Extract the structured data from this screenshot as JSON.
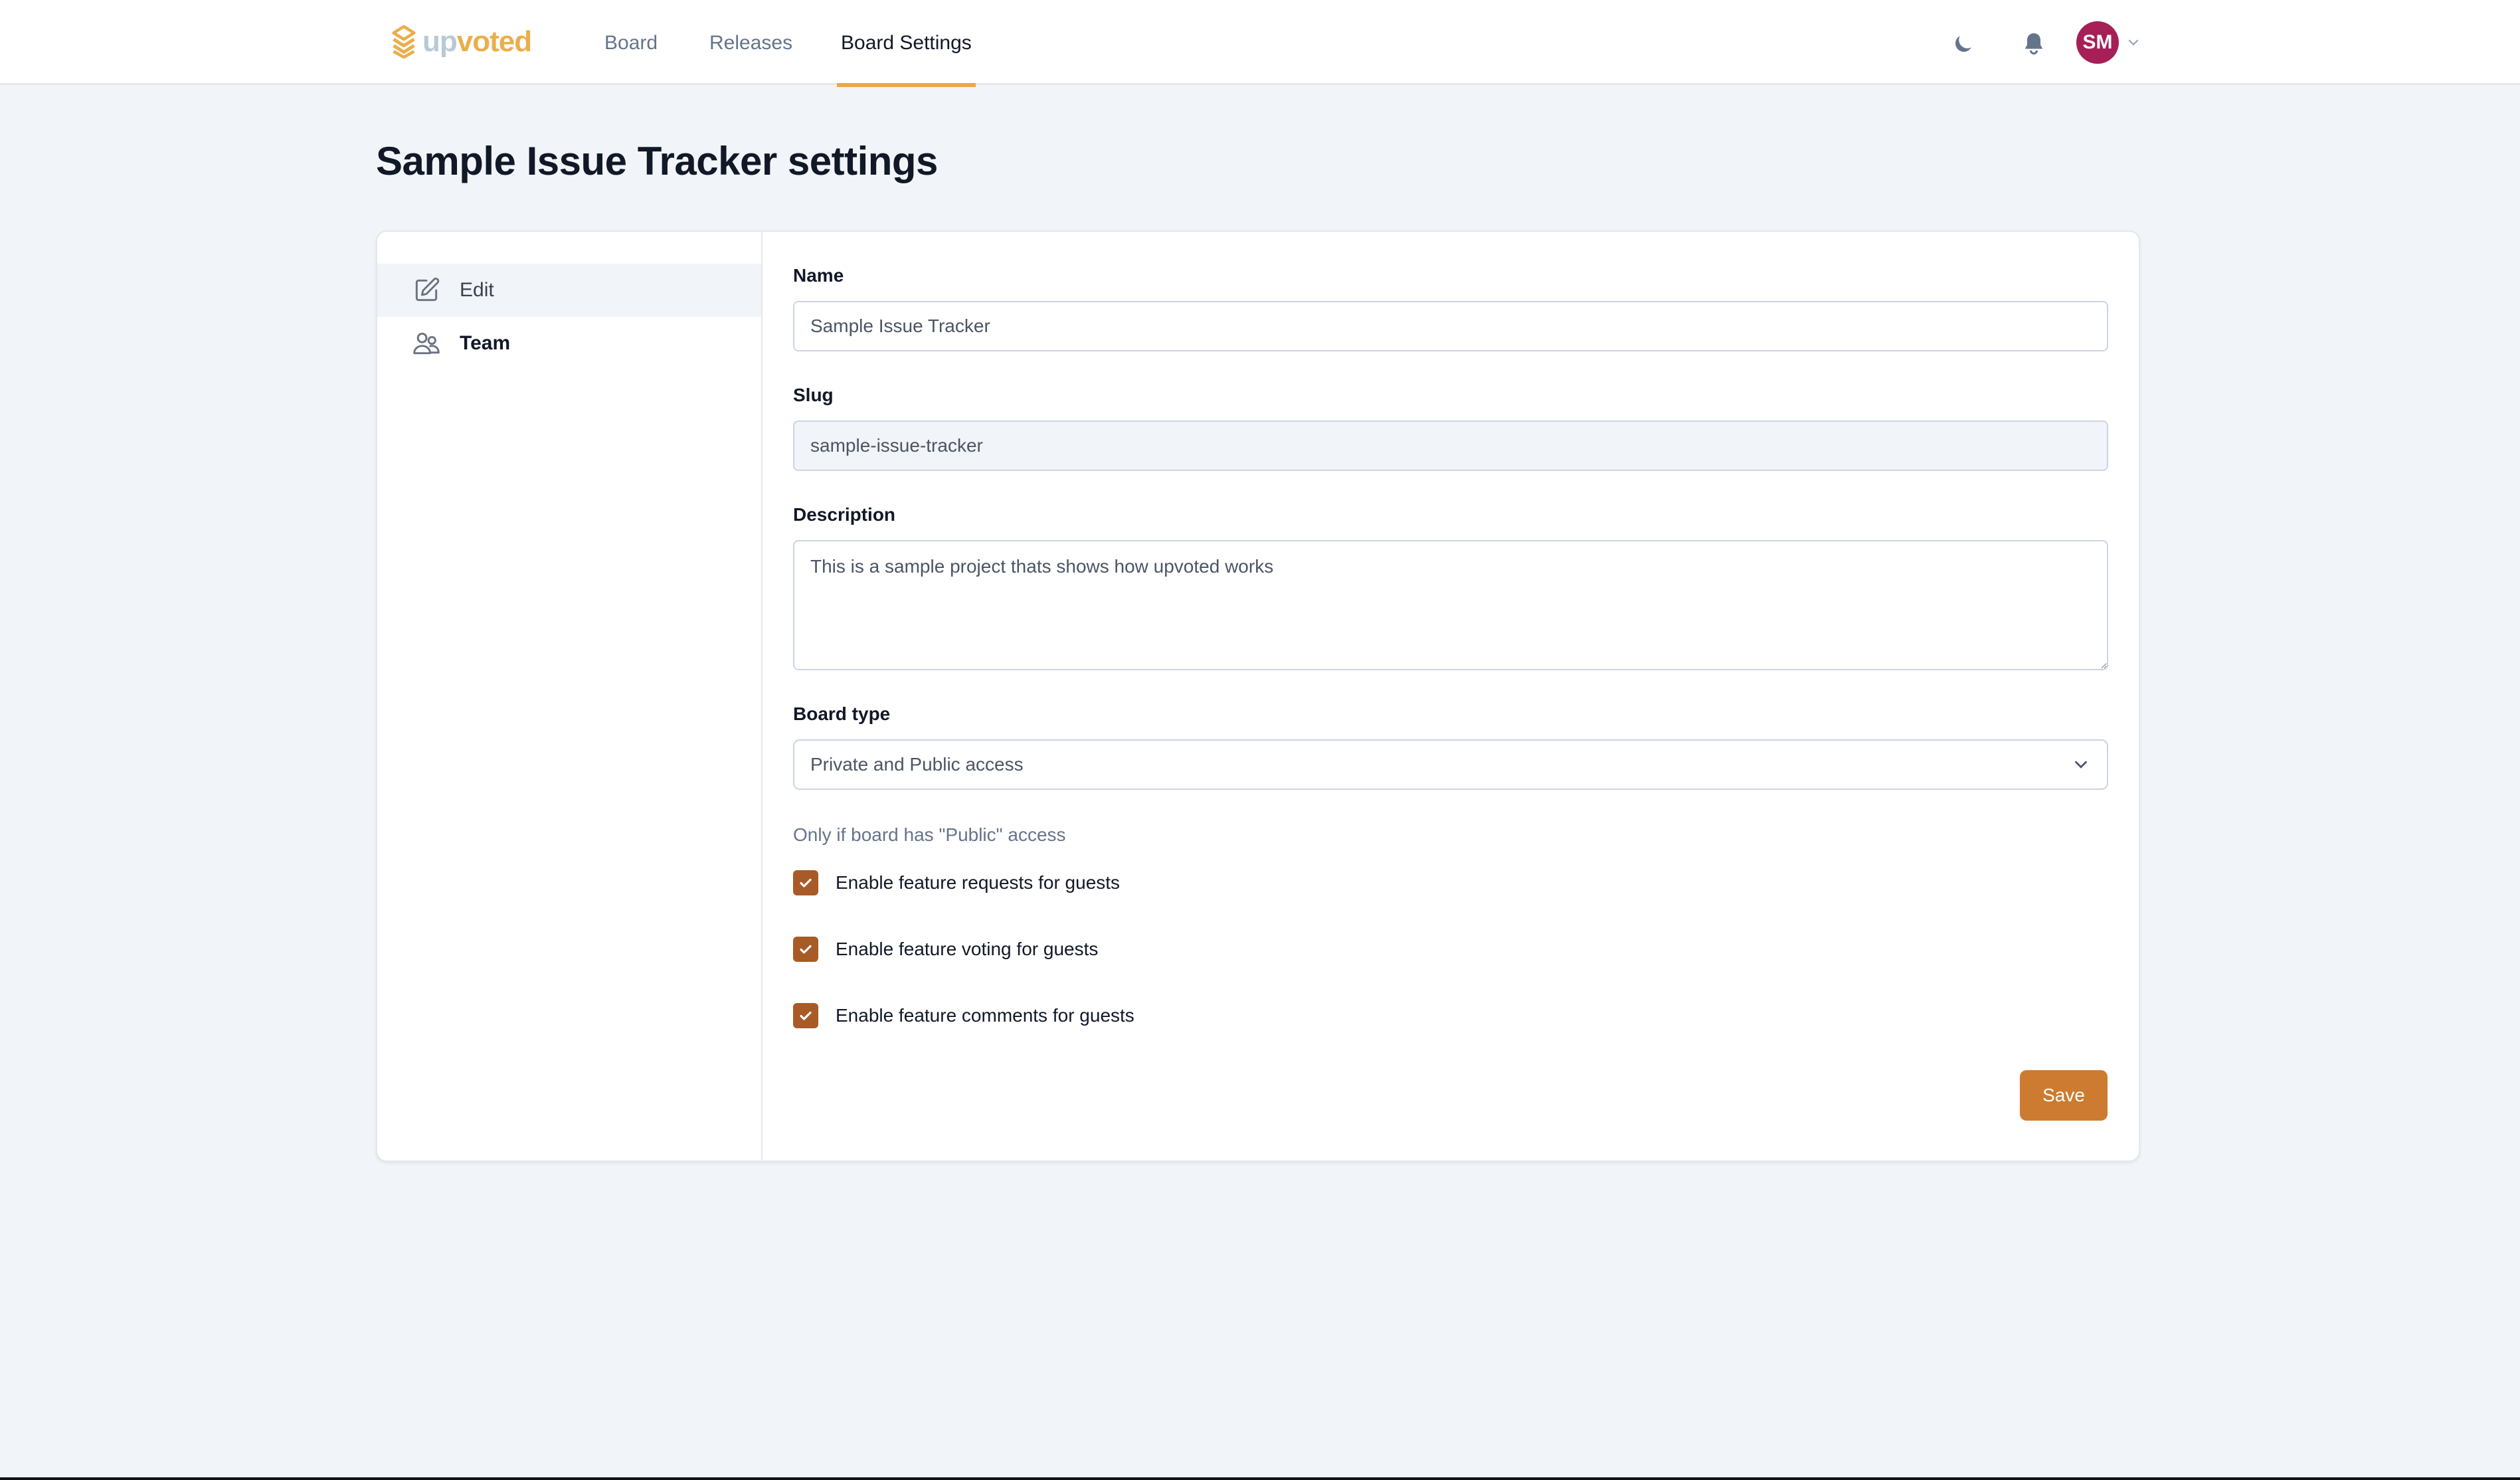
{
  "header": {
    "logo": {
      "part1": "up",
      "part2": "voted",
      "icon": "stack-logo-icon"
    },
    "nav": [
      {
        "label": "Board",
        "active": false
      },
      {
        "label": "Releases",
        "active": false
      },
      {
        "label": "Board Settings",
        "active": true
      }
    ],
    "icons": [
      "moon-icon",
      "bell-icon"
    ],
    "user": {
      "initials": "SM",
      "avatar_color": "#a61f57"
    }
  },
  "page": {
    "title": "Sample Issue Tracker settings"
  },
  "sidebar": {
    "items": [
      {
        "label": "Edit",
        "icon": "edit-icon",
        "active": true
      },
      {
        "label": "Team",
        "icon": "users-icon",
        "active": false
      }
    ]
  },
  "form": {
    "name": {
      "label": "Name",
      "value": "Sample Issue Tracker"
    },
    "slug": {
      "label": "Slug",
      "value": "sample-issue-tracker"
    },
    "description": {
      "label": "Description",
      "value": "This is a sample project thats shows how upvoted works"
    },
    "board_type": {
      "label": "Board type",
      "value": "Private and Public access"
    },
    "public_hint": "Only if board has \"Public\" access",
    "checkboxes": [
      {
        "label": "Enable feature requests for guests",
        "checked": true
      },
      {
        "label": "Enable feature voting for guests",
        "checked": true
      },
      {
        "label": "Enable feature comments for guests",
        "checked": true
      }
    ],
    "save_label": "Save"
  },
  "colors": {
    "accent": "#e9a84a",
    "checkbox": "#a85a27",
    "save_button": "#cc7b30",
    "background": "#f1f4f8"
  }
}
